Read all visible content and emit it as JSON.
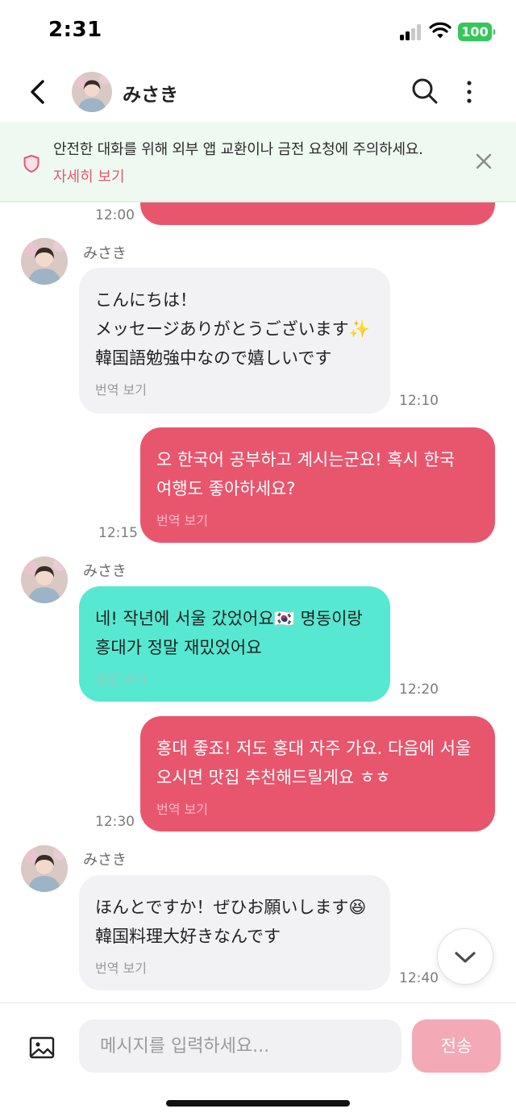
{
  "status_bar": {
    "time": "2:31",
    "battery": "100"
  },
  "header": {
    "contact_name": "みさき"
  },
  "notice": {
    "text": "안전한 대화를 위해 외부 앱 교환이나 금전 요청에 주의하세요.",
    "link": "자세히 보기"
  },
  "messages": [
    {
      "direction": "out",
      "text": "",
      "time": "12:00"
    },
    {
      "direction": "in",
      "sender": "みさき",
      "text": "こんにちは！メッセージありがとうございます✨ 韓国語勉強中なので嬉しいです",
      "translate": "번역 보기",
      "time": "12:10"
    },
    {
      "direction": "out",
      "text": "오 한국어 공부하고 계시는군요! 혹시 한국 여행도 좋아하세요?",
      "translate": "번역 보기",
      "time": "12:15"
    },
    {
      "direction": "in",
      "sender": "みさき",
      "text": "네! 작년에 서울 갔었어요🇰🇷 명동이랑 홍대가 정말 재밌었어요",
      "translate": "원문 보기",
      "time": "12:20",
      "translated": true
    },
    {
      "direction": "out",
      "text": "홍대 좋죠! 저도 홍대 자주 가요. 다음에 서울 오시면 맛집 추천해드릴게요 ㅎㅎ",
      "translate": "번역 보기",
      "time": "12:30"
    },
    {
      "direction": "in",
      "sender": "みさき",
      "text": "ほんとですか！ぜひお願いします😆 韓国料理大好きなんです",
      "translate": "번역 보기",
      "time": "12:40"
    }
  ],
  "input": {
    "placeholder": "메시지를 입력하세요...",
    "value": "",
    "send_label": "전송"
  },
  "colors": {
    "accent": "#e8566e",
    "incoming": "#f2f2f4",
    "translated": "#57e8d2",
    "notice_bg": "#eefaf1",
    "send_disabled": "#f3a9b6"
  },
  "icons": [
    "back-icon",
    "search-icon",
    "more-icon",
    "shield-icon",
    "close-icon",
    "chevron-down-icon",
    "image-icon"
  ]
}
